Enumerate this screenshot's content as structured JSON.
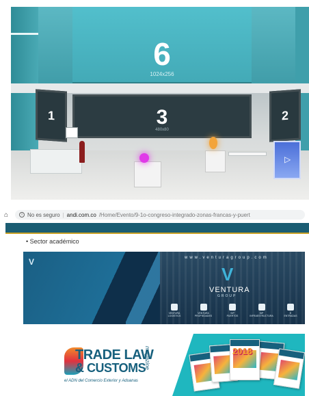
{
  "scene": {
    "top_screen": {
      "number": "6",
      "resolution": "1024x256"
    },
    "center_screen": {
      "number": "3",
      "resolution": "480x80"
    },
    "left_screen": {
      "number": "1"
    },
    "right_screen": {
      "number": "2"
    },
    "kiosk_icon": "play-icon"
  },
  "browser": {
    "home_icon": "home-icon",
    "info_icon": "info-icon",
    "security_label": "No es seguro",
    "separator": "|",
    "domain": "andi.com.co",
    "path": "/Home/Evento/9-1o-congreso-integrado-zonas-francas-y-puert"
  },
  "site": {
    "band_color": "#1b5d73",
    "accent_color": "#c9a227",
    "bullet_item": "Sector académico"
  },
  "ventura_banner": {
    "website": "www.venturagroup.com",
    "brand": "VENTURA",
    "group": "GROUP",
    "logos": [
      {
        "label": "VENTURA\nLOGISTICS"
      },
      {
        "label": "VENTURA\nPROPIEDADES"
      },
      {
        "label": "SIP\nPUERTOS"
      },
      {
        "label": "SIP\nINFRAESTRUCTURA"
      },
      {
        "label": "E\nENTRADAS"
      }
    ]
  },
  "tradelaw_banner": {
    "title_line1": "TRADE LAW",
    "title_line2": "& CUSTOMS",
    "magazine": "magazine",
    "subtitle": "el ADN del Comercio Exterior y Aduanas",
    "cover_year": "2018",
    "panel_color": "#1fb7bf"
  }
}
